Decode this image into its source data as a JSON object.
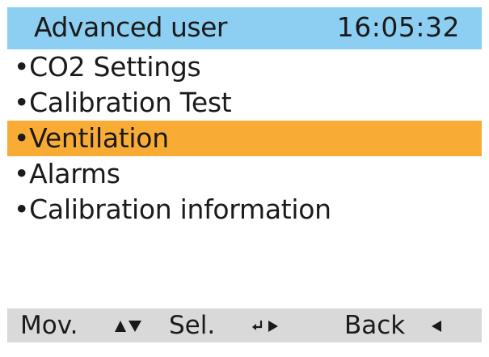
{
  "header": {
    "title": "Advanced user",
    "time": "16:05:32"
  },
  "menu": {
    "selected_index": 2,
    "items": [
      {
        "label": "•CO2 Settings"
      },
      {
        "label": "•Calibration Test"
      },
      {
        "label": "•Ventilation"
      },
      {
        "label": "•Alarms"
      },
      {
        "label": "•Calibration information"
      }
    ]
  },
  "footer": {
    "move_label": "Mov.",
    "move_icon": "up-down-arrows-icon",
    "select_label": "Sel.",
    "select_icon": "enter-icon",
    "back_label": "Back",
    "back_icon": "left-triangle-icon"
  },
  "colors": {
    "header_bg": "#8ccff2",
    "selected_bg": "#f9ac35",
    "footer_bg": "#d9d9d9"
  }
}
